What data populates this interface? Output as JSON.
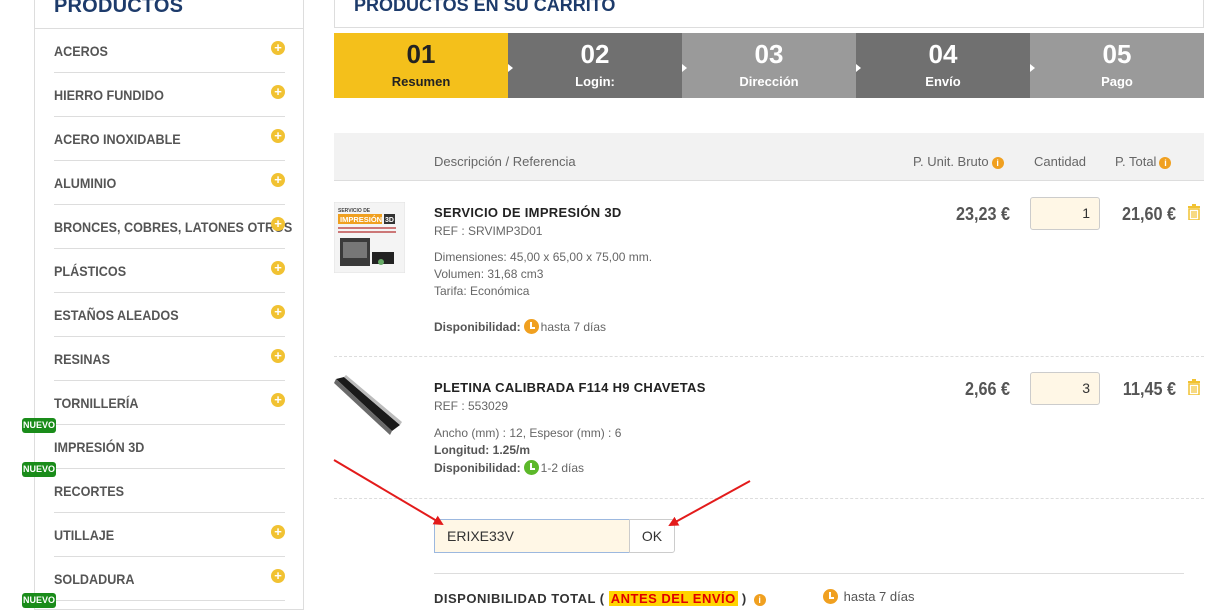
{
  "sidebar": {
    "title": "PRODUCTOS",
    "items": [
      {
        "label": "ACEROS",
        "badge": "",
        "has_plus": true
      },
      {
        "label": "HIERRO FUNDIDO",
        "badge": "",
        "has_plus": true
      },
      {
        "label": "ACERO INOXIDABLE",
        "badge": "",
        "has_plus": true
      },
      {
        "label": "ALUMINIO",
        "badge": "",
        "has_plus": true
      },
      {
        "label": "BRONCES, COBRES, LATONES OTROS",
        "badge": "",
        "has_plus": true
      },
      {
        "label": "PLÁSTICOS",
        "badge": "",
        "has_plus": true
      },
      {
        "label": "ESTAÑOS ALEADOS",
        "badge": "",
        "has_plus": true
      },
      {
        "label": "RESINAS",
        "badge": "",
        "has_plus": true
      },
      {
        "label": "TORNILLERÍA",
        "badge": "",
        "has_plus": true
      },
      {
        "label": "IMPRESIÓN 3D",
        "badge": "NUEVO",
        "has_plus": false
      },
      {
        "label": "RECORTES",
        "badge": "NUEVO",
        "has_plus": false
      },
      {
        "label": "UTILLAJE",
        "badge": "",
        "has_plus": true
      },
      {
        "label": "SOLDADURA",
        "badge": "",
        "has_plus": true
      }
    ],
    "partial_badge": "NUEVO"
  },
  "cart": {
    "title": "PRODUCTOS EN SU CARRITO"
  },
  "steps": [
    {
      "num": "01",
      "label": "Resumen",
      "state": "active"
    },
    {
      "num": "02",
      "label": "Login:",
      "state": "dark"
    },
    {
      "num": "03",
      "label": "Dirección",
      "state": "light"
    },
    {
      "num": "04",
      "label": "Envío",
      "state": "dark"
    },
    {
      "num": "05",
      "label": "Pago",
      "state": "light"
    }
  ],
  "table": {
    "col_desc": "Descripción / Referencia",
    "col_unit": "P. Unit. Bruto",
    "col_qty": "Cantidad",
    "col_total": "P. Total"
  },
  "products": [
    {
      "name": "SERVICIO DE IMPRESIÓN 3D",
      "ref": "REF : SRVIMP3D01",
      "details": [
        "Dimensiones: 45,00 x 65,00 x 75,00 mm.",
        "Volumen: 31,68 cm3",
        "Tarifa: Económica"
      ],
      "availability_label": "Disponibilidad:",
      "availability": "hasta 7 días",
      "unit_price": "23,23 €",
      "quantity": "1",
      "total": "21,60 €",
      "thumb_text_top": "SERVICIO DE",
      "thumb_text_main": "IMPRESIÓN",
      "thumb_text_badge": "3D"
    },
    {
      "name": "PLETINA CALIBRADA F114 H9 CHAVETAS",
      "ref": "REF : 553029",
      "details": [
        "Ancho (mm) : 12, Espesor (mm) : 6"
      ],
      "length_label": "Longitud:",
      "length_value": "1.25/m",
      "availability_label": "Disponibilidad:",
      "availability": "1-2 días",
      "unit_price": "2,66 €",
      "quantity": "3",
      "total": "11,45 €"
    }
  ],
  "coupon": {
    "value": "ERIXE33V",
    "button": "OK"
  },
  "availability_total": {
    "prefix": "DISPONIBILIDAD TOTAL (",
    "highlight": "ANTES DEL ENVÍO",
    "suffix": ")",
    "days": "hasta 7 días"
  },
  "colors": {
    "accent_yellow": "#f4c01b",
    "brand_navy": "#1d3b6b",
    "nuevo_green": "#1a8c1a",
    "annotation_arrow": "#e31b1b"
  }
}
